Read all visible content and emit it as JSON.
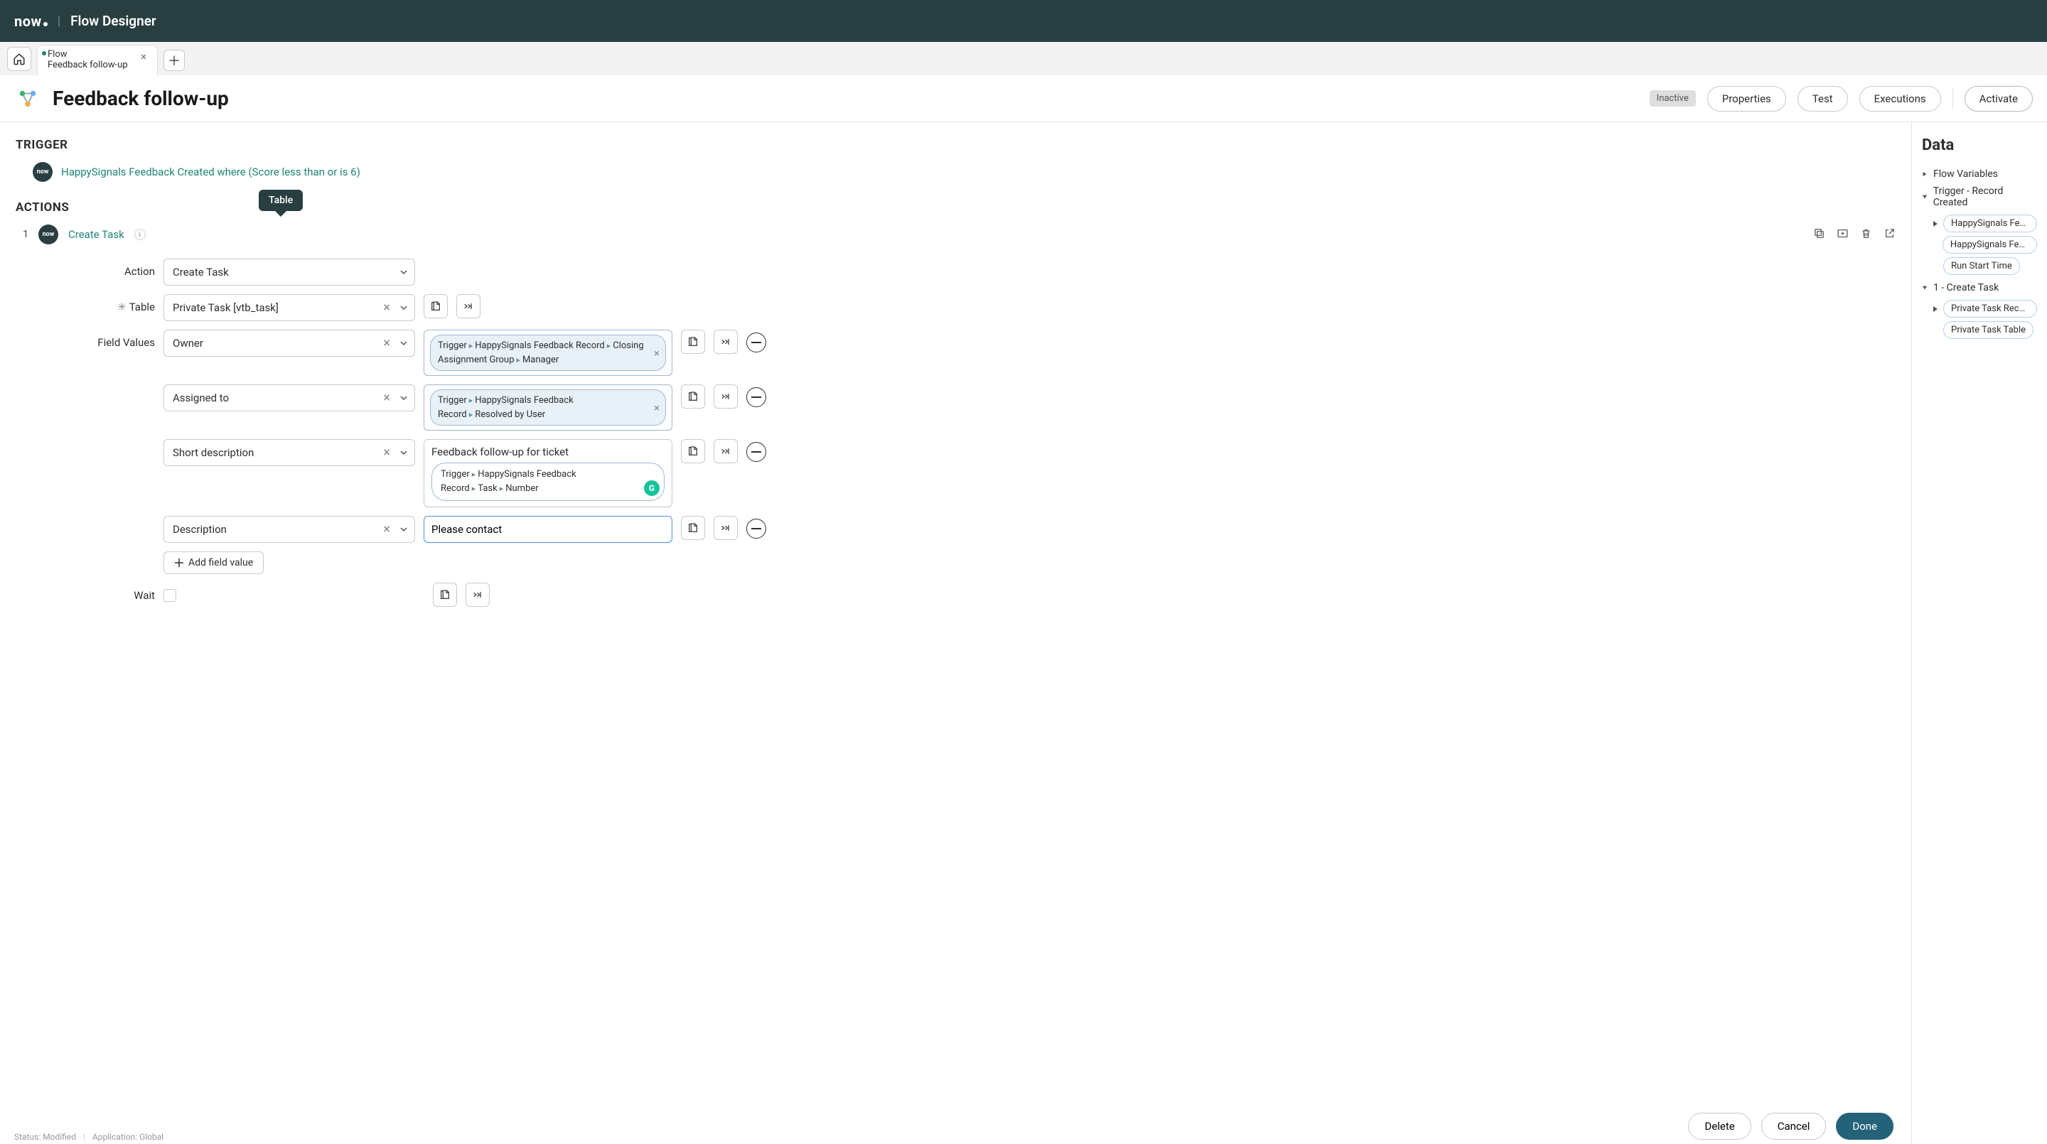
{
  "brand": {
    "logo_text": "now",
    "product": "Flow Designer"
  },
  "tab": {
    "line1": "Flow",
    "line2": "Feedback follow-up"
  },
  "header": {
    "title": "Feedback follow-up",
    "status": "Inactive",
    "buttons": {
      "properties": "Properties",
      "test": "Test",
      "executions": "Executions",
      "activate": "Activate"
    }
  },
  "canvas": {
    "trigger_label": "TRIGGER",
    "trigger_text": "HappySignals Feedback Created where (Score less than or is 6)",
    "tooltip": "Table",
    "actions_label": "ACTIONS",
    "step": {
      "index": "1",
      "name": "Create Task",
      "form": {
        "action": {
          "label": "Action",
          "value": "Create Task"
        },
        "table": {
          "label": "Table",
          "value": "Private Task [vtb_task]"
        },
        "field_values": {
          "label": "Field Values",
          "rows": [
            {
              "field": "Owner",
              "pill": "Trigger ▸ HappySignals Feedback Record ▸ Closing Assignment Group ▸ Manager"
            },
            {
              "field": "Assigned to",
              "pill": "Trigger ▸ HappySignals Feedback Record ▸ Resolved by User"
            },
            {
              "field": "Short description",
              "text": "Feedback follow-up for ticket",
              "pill": "Trigger ▸ HappySignals Feedback Record ▸ Task ▸ Number"
            },
            {
              "field": "Description",
              "input": "Please contact "
            }
          ],
          "add": "Add field value"
        },
        "wait": {
          "label": "Wait"
        }
      }
    }
  },
  "data_panel": {
    "title": "Data",
    "items": {
      "flow_vars": "Flow Variables",
      "trigger": "Trigger - Record Created",
      "trigger_pills": [
        "HappySignals Feedba",
        "HappySignals Feedba",
        "Run Start Time"
      ],
      "create_task": "1 - Create Task",
      "ct_pills": [
        "Private Task Record",
        "Private Task Table"
      ]
    }
  },
  "footer": {
    "delete": "Delete",
    "cancel": "Cancel",
    "done": "Done"
  },
  "status_line": {
    "status": "Status: Modified",
    "app": "Application: Global"
  }
}
